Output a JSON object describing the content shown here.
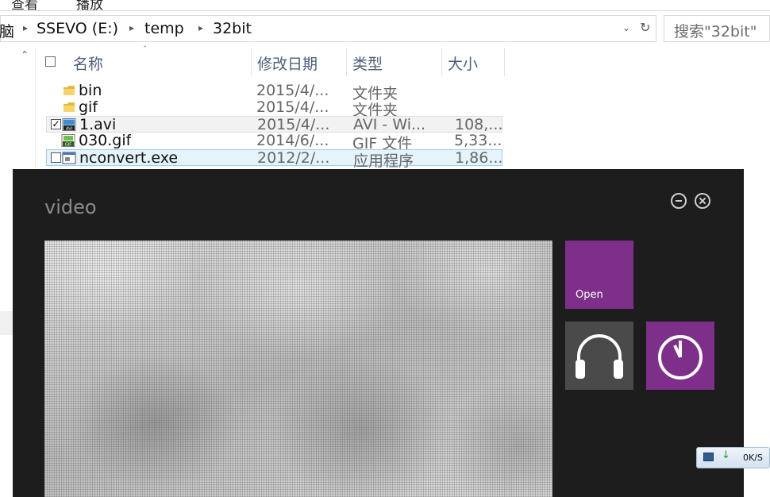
{
  "ribbon": {
    "tabs": [
      "查看",
      "播放"
    ]
  },
  "address": {
    "crumbs": [
      "脑",
      "SSEVO (E:)",
      "temp",
      "32bit"
    ],
    "search_placeholder": "搜索\"32bit\""
  },
  "columns": {
    "name": "名称",
    "date": "修改日期",
    "type": "类型",
    "size": "大小"
  },
  "files": [
    {
      "name": "bin",
      "date": "2015/4/...",
      "type": "文件夹",
      "size": "",
      "icon": "folder-icon"
    },
    {
      "name": "gif",
      "date": "2015/4/...",
      "type": "文件夹",
      "size": "",
      "icon": "folder-icon"
    },
    {
      "name": "1.avi",
      "date": "2015/4/...",
      "type": "AVI - Wi...",
      "size": "108,...",
      "icon": "avi-file-icon",
      "checked": true
    },
    {
      "name": "030.gif",
      "date": "2014/6/...",
      "type": "GIF 文件",
      "size": "5,33...",
      "icon": "gif-file-icon"
    },
    {
      "name": "nconvert.exe",
      "date": "2012/2/...",
      "type": "应用程序",
      "size": "1,86...",
      "icon": "exe-file-icon",
      "checked": false
    }
  ],
  "video_window": {
    "title": "video",
    "open_tile_label": "Open",
    "accent_color": "#7d2f8a",
    "tiles": [
      "open-tile",
      "headphones-icon",
      "clock-icon"
    ]
  },
  "net_widget": {
    "speed": "0K/S"
  }
}
